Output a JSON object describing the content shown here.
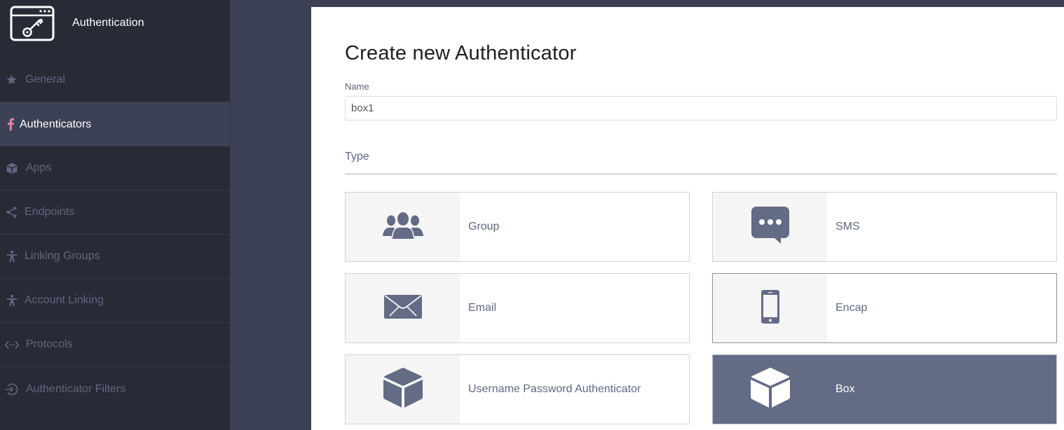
{
  "app": {
    "title": "Authentication",
    "logo_icon": "browser-window-key-icon"
  },
  "sidebar": {
    "items": [
      {
        "label": "General",
        "icon": "star-icon",
        "active": false
      },
      {
        "label": "Authenticators",
        "icon": "facebook-f-icon",
        "active": true
      },
      {
        "label": "Apps",
        "icon": "cube-icon",
        "active": false
      },
      {
        "label": "Endpoints",
        "icon": "share-icon",
        "active": false
      },
      {
        "label": "Linking Groups",
        "icon": "person-icon",
        "active": false
      },
      {
        "label": "Account Linking",
        "icon": "person-icon",
        "active": false
      },
      {
        "label": "Protocols",
        "icon": "code-arrows-icon",
        "active": false
      },
      {
        "label": "Authenticator Filters",
        "icon": "sign-in-circle-icon",
        "active": false
      }
    ]
  },
  "main": {
    "title": "Create new Authenticator",
    "name_field": {
      "label": "Name",
      "value": "box1"
    },
    "type_section": {
      "label": "Type",
      "options": [
        {
          "label": "Group",
          "icon": "users-icon",
          "state": "default"
        },
        {
          "label": "SMS",
          "icon": "chat-bubble-icon",
          "state": "default"
        },
        {
          "label": "Email",
          "icon": "envelope-icon",
          "state": "default"
        },
        {
          "label": "Encap",
          "icon": "mobile-phone-icon",
          "state": "hover"
        },
        {
          "label": "Username Password Authenticator",
          "icon": "cube-icon",
          "state": "default"
        },
        {
          "label": "Box",
          "icon": "cube-icon",
          "state": "selected"
        }
      ]
    }
  },
  "colors": {
    "sidebar_bg": "#272b35",
    "sidebar_active_bg": "#3c4155",
    "page_bg": "#3c4054",
    "accent_pink": "#e27fa8",
    "icon_slate": "#636b85",
    "selected_card_bg": "#636b85"
  }
}
